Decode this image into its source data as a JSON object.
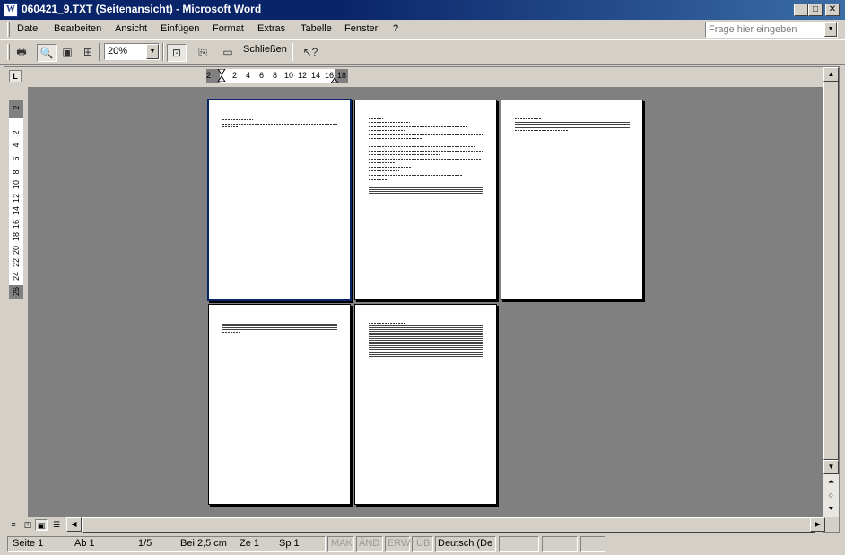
{
  "window": {
    "title": "060421_9.TXT (Seitenansicht) - Microsoft Word",
    "app_icon": "W",
    "buttons": {
      "minimize": "_",
      "maximize": "□",
      "close": "✕"
    }
  },
  "menu": {
    "items": [
      "Datei",
      "Bearbeiten",
      "Ansicht",
      "Einfügen",
      "Format",
      "Extras",
      "Tabelle",
      "Fenster",
      "?"
    ],
    "help_placeholder": "Frage hier eingeben"
  },
  "toolbar": {
    "zoom": "20%",
    "close_label": "Schließen",
    "icons": [
      "print-icon",
      "magnifier-icon",
      "one-page-icon",
      "multiple-pages-icon",
      "view-ruler-icon",
      "shrink-to-fit-icon",
      "full-screen-icon",
      "context-help-icon"
    ]
  },
  "ruler": {
    "corner": "L",
    "h_ticks": [
      "2",
      "2",
      "4",
      "6",
      "8",
      "10",
      "12",
      "14",
      "16",
      "18"
    ],
    "v_ticks": [
      "2",
      "2",
      "4",
      "6",
      "8",
      "10",
      "12",
      "14",
      "16",
      "18",
      "20",
      "22",
      "24",
      "26"
    ]
  },
  "pages": {
    "count": 5,
    "active": 1
  },
  "status": {
    "page": "Seite 1",
    "section": "Ab 1",
    "pages": "1/5",
    "at": "Bei 2,5 cm",
    "line": "Ze 1",
    "col": "Sp 1",
    "mak": "MAK",
    "aend": "ÄND",
    "erw": "ERW",
    "ueb": "ÜB",
    "language": "Deutsch (De"
  },
  "colors": {
    "titlebar": "#0a246a",
    "canvas": "#808080",
    "chrome": "#d4d0c8"
  }
}
